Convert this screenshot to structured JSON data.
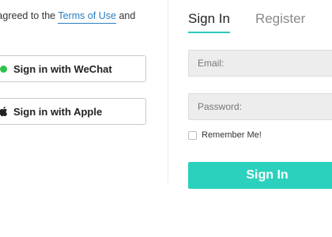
{
  "terms": {
    "prefix": "d agreed to the",
    "link": "Terms of Use",
    "suffix": "and"
  },
  "social": {
    "wechat_label": "Sign in with WeChat",
    "apple_label": "Sign in with Apple"
  },
  "tabs": {
    "signin": "Sign In",
    "register": "Register"
  },
  "form": {
    "email_placeholder": "Email:",
    "password_placeholder": "Password:",
    "remember_label": "Remember Me!",
    "submit_label": "Sign In"
  },
  "colors": {
    "accent": "#2bd1bd",
    "link": "#2a7fc4",
    "wechat": "#2ec24a"
  },
  "icons": {
    "wechat": "wechat-icon",
    "apple": "apple-icon"
  }
}
